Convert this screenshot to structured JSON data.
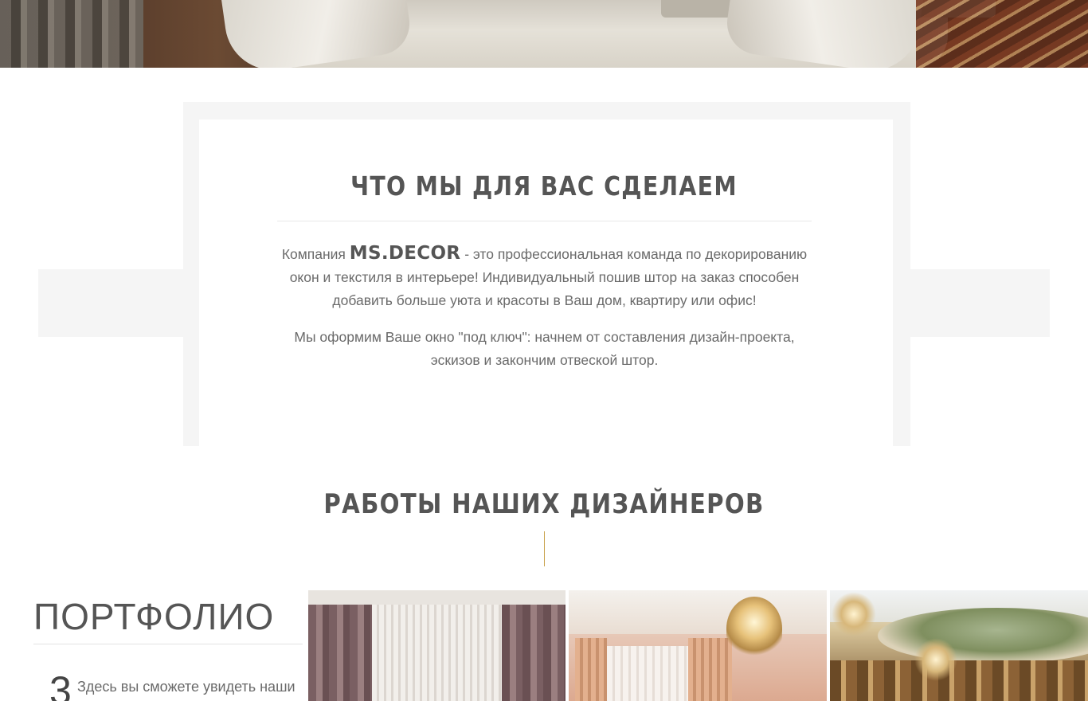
{
  "services": {
    "title": "ЧТО МЫ ДЛЯ ВАС СДЕЛАЕМ",
    "para1_prefix": "Компания",
    "brand": "MS.DECOR",
    "para1_suffix": " - это профессиональная команда по декорированию окон и текстиля в интерьере! Индивидуальный пошив штор на заказ способен добавить больше уюта и красоты в Ваш дом, квартиру или офис!",
    "para2": "Мы оформим Ваше окно \"под ключ\": начнем от составления дизайн-проекта, эскизов и закончим отвеской штор."
  },
  "works": {
    "title": "РАБОТЫ НАШИХ ДИЗАЙНЕРОВ"
  },
  "portfolio": {
    "title": "ПОРТФОЛИО",
    "digit": "3",
    "description": "Здесь вы сможете увидеть наши"
  },
  "colors": {
    "accent_gold": "#c9a24c",
    "heading": "#555555",
    "text": "#6a6a6a",
    "panel": "#f5f5f5"
  }
}
